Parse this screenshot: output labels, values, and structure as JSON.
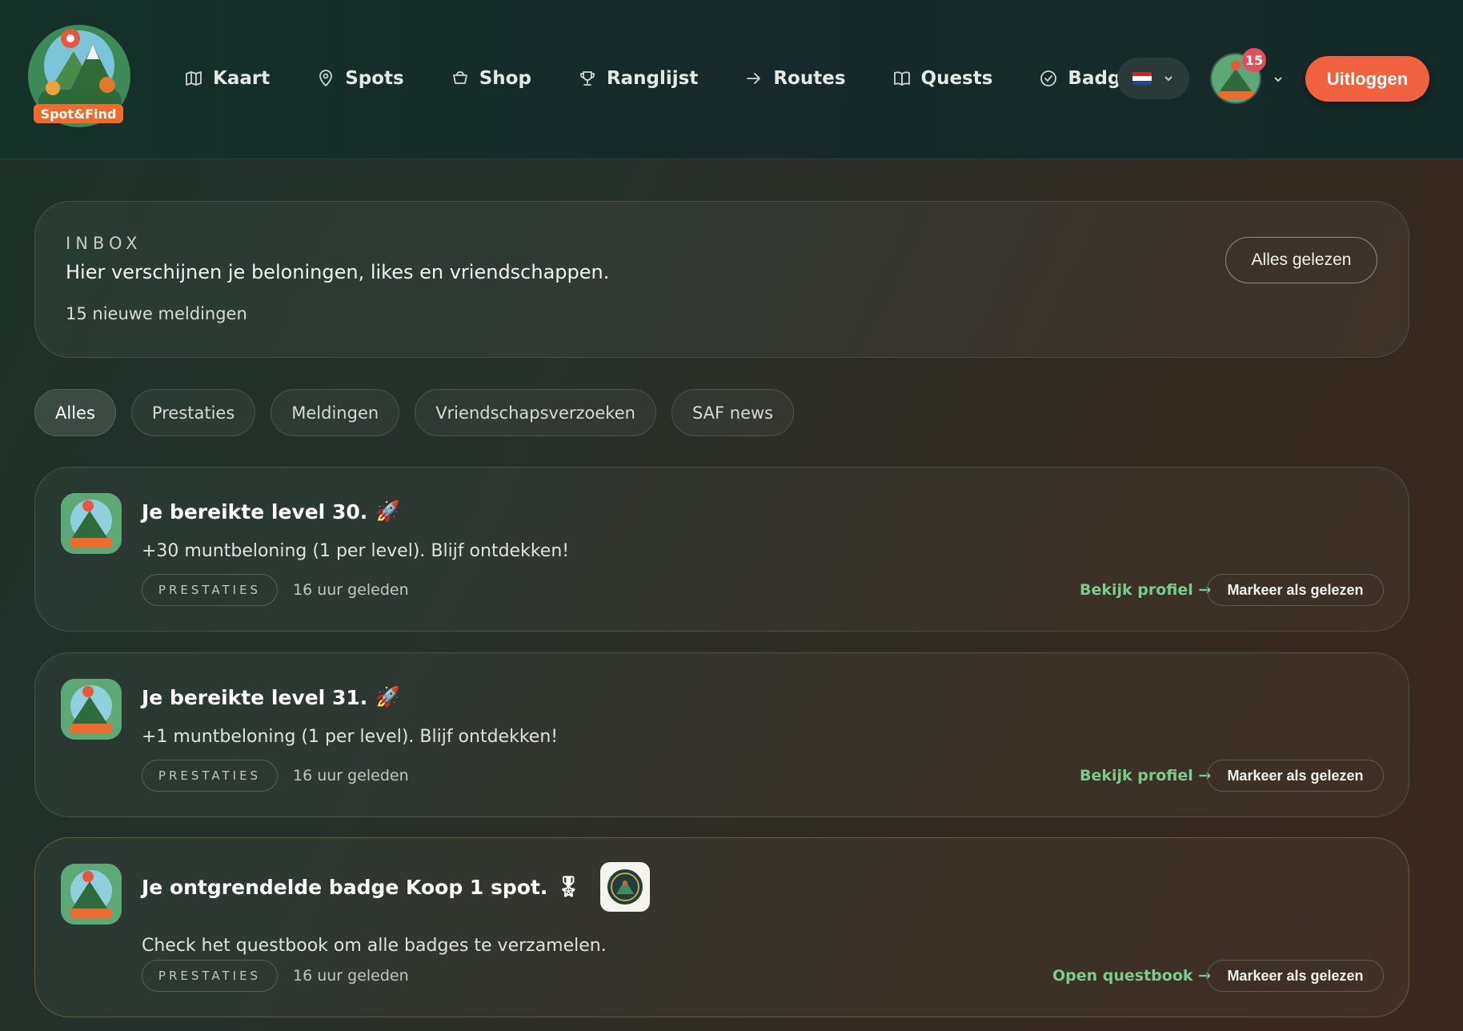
{
  "brand": {
    "logo_text": "Spot&Find"
  },
  "nav": [
    {
      "label": "Kaart",
      "icon": "map-icon"
    },
    {
      "label": "Spots",
      "icon": "pin-icon"
    },
    {
      "label": "Shop",
      "icon": "basket-icon"
    },
    {
      "label": "Ranglijst",
      "icon": "trophy-icon"
    },
    {
      "label": "Routes",
      "icon": "arrow-right-icon"
    },
    {
      "label": "Quests",
      "icon": "book-icon"
    },
    {
      "label": "Badges",
      "icon": "check-circle-icon"
    }
  ],
  "header": {
    "language_flag": "flag-nl-icon",
    "notification_count": "15",
    "logout_label": "Uitloggen"
  },
  "inbox": {
    "kicker": "INBOX",
    "title": "Hier verschijnen je beloningen, likes en vriendschappen.",
    "count_text": "15 nieuwe meldingen",
    "read_all_label": "Alles gelezen"
  },
  "tabs": [
    {
      "label": "Alles",
      "active": true
    },
    {
      "label": "Prestaties",
      "active": false
    },
    {
      "label": "Meldingen",
      "active": false
    },
    {
      "label": "Vriendschapsverzoeken",
      "active": false
    },
    {
      "label": "SAF news",
      "active": false
    }
  ],
  "notifications": [
    {
      "title": "Je bereikte level 30.",
      "emoji": "🚀",
      "body": "+30 muntbeloning (1 per level). Blijf ontdekken!",
      "category": "PRESTATIES",
      "time": "16 uur geleden",
      "action_label": "Bekijk profiel →",
      "mark_label": "Markeer als gelezen"
    },
    {
      "title": "Je bereikte level 31.",
      "emoji": "🚀",
      "body": "+1 muntbeloning (1 per level). Blijf ontdekken!",
      "category": "PRESTATIES",
      "time": "16 uur geleden",
      "action_label": "Bekijk profiel →",
      "mark_label": "Markeer als gelezen"
    },
    {
      "title": "Je ontgrendelde badge Koop 1 spot.",
      "emoji": "🎖",
      "body": "Check het questbook om alle badges te verzamelen.",
      "category": "PRESTATIES",
      "time": "16 uur geleden",
      "action_label": "Open questbook →",
      "mark_label": "Markeer als gelezen"
    }
  ],
  "colors": {
    "accent_orange": "#f0623f",
    "link_green": "#7ec98d",
    "badge_red": "#e44d5a"
  }
}
